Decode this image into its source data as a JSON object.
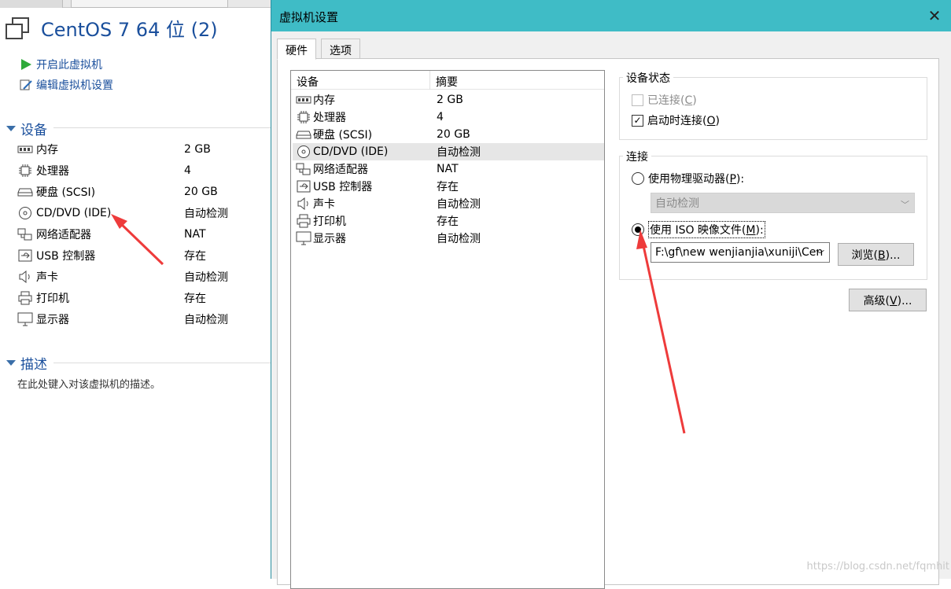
{
  "vm": {
    "title": "CentOS 7 64 位 (2)",
    "actions": [
      {
        "label": "开启此虚拟机",
        "icon": "play-icon"
      },
      {
        "label": "编辑虚拟机设置",
        "icon": "edit-settings-icon"
      }
    ],
    "devices_section": "设备",
    "devices": [
      {
        "name": "内存",
        "value": "2 GB",
        "icon": "memory-icon"
      },
      {
        "name": "处理器",
        "value": "4",
        "icon": "cpu-icon"
      },
      {
        "name": "硬盘 (SCSI)",
        "value": "20 GB",
        "icon": "hard-disk-icon"
      },
      {
        "name": "CD/DVD (IDE)",
        "value": "自动检测",
        "icon": "cd-dvd-icon"
      },
      {
        "name": "网络适配器",
        "value": "NAT",
        "icon": "network-adapter-icon"
      },
      {
        "name": "USB 控制器",
        "value": "存在",
        "icon": "usb-icon"
      },
      {
        "name": "声卡",
        "value": "自动检测",
        "icon": "speaker-icon"
      },
      {
        "name": "打印机",
        "value": "存在",
        "icon": "printer-icon"
      },
      {
        "name": "显示器",
        "value": "自动检测",
        "icon": "monitor-icon"
      }
    ],
    "description_section": "描述",
    "description_text": "在此处键入对该虚拟机的描述。"
  },
  "dialog": {
    "title": "虚拟机设置",
    "close_glyph": "✕",
    "tabs": [
      {
        "label": "硬件",
        "active": true
      },
      {
        "label": "选项",
        "active": false
      }
    ],
    "list_header": {
      "device": "设备",
      "summary": "摘要"
    },
    "selected_device": "CD/DVD (IDE)",
    "device_status": {
      "title": "设备状态",
      "connected": {
        "label": "已连接(",
        "key": "C",
        "suffix": ")",
        "checked": false,
        "enabled": false
      },
      "connect_at_power_on": {
        "label": "启动时连接(",
        "key": "O",
        "suffix": ")",
        "checked": true,
        "enabled": true
      }
    },
    "connection": {
      "title": "连接",
      "physical_drive": {
        "label": "使用物理驱动器(",
        "key": "P",
        "suffix": "):",
        "selected": false
      },
      "physical_drive_value": "自动检测",
      "iso_file": {
        "label": "使用 ISO 映像文件(",
        "key": "M",
        "suffix": "):",
        "selected": true
      },
      "iso_path": "F:\\gf\\new wenjianjia\\xuniji\\Cen",
      "browse_button": {
        "label": "浏览(",
        "key": "B",
        "suffix": ")..."
      }
    },
    "advanced_button": {
      "label": "高级(",
      "key": "V",
      "suffix": ")..."
    }
  },
  "watermark": "https://blog.csdn.net/fqmhit",
  "colors": {
    "titlebar": "#3fbcc6",
    "link": "#1a4f9c",
    "annotation_arrow": "#ee3b3b"
  }
}
